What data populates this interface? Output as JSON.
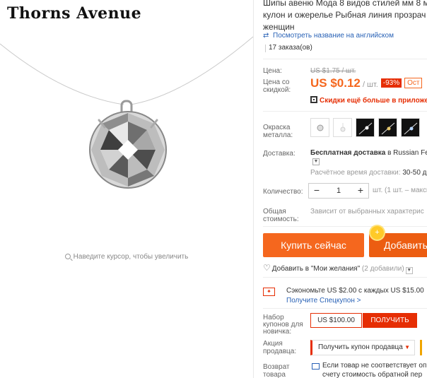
{
  "brand": "Thorns Avenue",
  "zoom_hint": "Наведите курсор, чтобы увеличить",
  "product": {
    "title_lines": [
      "Шипы авеню Мода 8 видов стилей мм 8 м",
      "кулон и ожерелье Рыбная линия прозрач",
      "женщин"
    ],
    "translate_link": "Посмотреть название на английском",
    "orders": "17 заказа(ов)"
  },
  "price": {
    "label": "Цена:",
    "old": "US $1.75 / шт.",
    "discounted_label_1": "Цена со",
    "discounted_label_2": "скидкой:",
    "current": "US $0.12",
    "unit": " / шт.",
    "discount_badge": "-93%",
    "extra_badge": "Ост",
    "app_note": "Скидки ещё больше в приложен"
  },
  "color": {
    "label_1": "Окраска",
    "label_2": "металла:"
  },
  "shipping": {
    "label": "Доставка:",
    "title_bold": "Бесплатная доставка",
    "title_rest": " в Russian Fe",
    "time_label": "Расчётное время доставки: ",
    "time_value": "30-50 д"
  },
  "quantity": {
    "label": "Количество:",
    "minus": "−",
    "value": "1",
    "plus": "+",
    "note": "шт. (1 шт. – макси"
  },
  "total": {
    "label_1": "Общая",
    "label_2": "стоимость:",
    "note": "Зависит от выбранных характерис"
  },
  "actions": {
    "buy_now": "Купить сейчас",
    "add_to_cart": "Добавить",
    "coin_symbol": "+"
  },
  "wishlist": {
    "label": "Добавить в \"Мои желания\"",
    "count": " (2 добавили)"
  },
  "savings": {
    "text": "Сэкономьте US $2.00 с каждых US $15.00",
    "link": "Получите Спецкупон >"
  },
  "new_user_coupon": {
    "label_1": "Набор",
    "label_2": "купонов для",
    "label_3": "новичка:",
    "amount": "US $100.00",
    "button": "ПОЛУЧИТЬ"
  },
  "seller_promo": {
    "label_1": "Акция",
    "label_2": "продавца:",
    "select": "Получить купон продавца"
  },
  "returns": {
    "label_1": "Возврат",
    "label_2": "товара",
    "text_1": "Если товар не соответствует опи",
    "text_2": "счету стоимость обратной пер"
  },
  "colors": {
    "accent": "#f5671e",
    "accent_dark": "#ec5d11",
    "sale_red": "#e62e04",
    "link_blue": "#2962b6"
  },
  "icons": [
    "search-icon",
    "translate-icon",
    "qr-icon",
    "heart-icon",
    "coupon-icon",
    "return-icon",
    "chevron-down-icon",
    "coin-icon"
  ]
}
